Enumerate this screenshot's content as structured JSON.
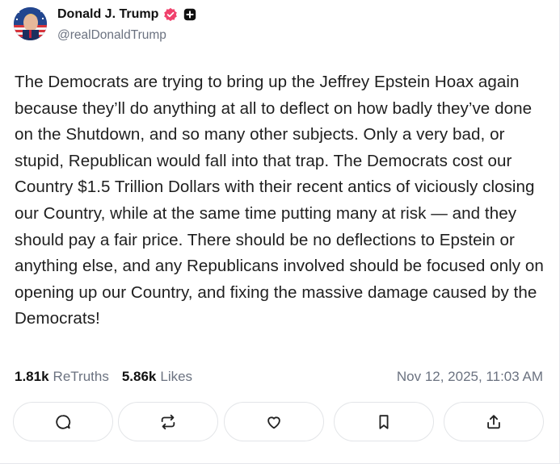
{
  "author": {
    "display_name": "Donald J. Trump",
    "handle": "@realDonaldTrump",
    "verified": true,
    "avatar_icon": "profile-avatar-flag"
  },
  "post": {
    "text": "The Democrats are trying to bring up the Jeffrey Epstein Hoax again because they’ll do anything at all to deflect on how badly they’ve done on the Shutdown, and so many other subjects. Only a very bad, or stupid, Republican would fall into that trap. The Democrats cost our Country $1.5 Trillion Dollars with their recent antics of viciously closing our Country, while at the same time putting many at risk — and they should pay a fair price. There should be no deflections to Epstein or anything else, and any Republicans involved should be focused only on opening up our Country, and fixing the massive damage caused by the Democrats!"
  },
  "stats": {
    "retruths_count": "1.81k",
    "retruths_label": "ReTruths",
    "likes_count": "5.86k",
    "likes_label": "Likes",
    "timestamp": "Nov 12, 2025, 11:03 AM"
  },
  "actions": [
    {
      "icon": "reply-icon"
    },
    {
      "icon": "retruth-icon"
    },
    {
      "icon": "like-icon"
    },
    {
      "icon": "bookmark-icon"
    },
    {
      "icon": "share-icon"
    }
  ],
  "colors": {
    "verified_badge": "#f0416c",
    "text": "#1f1f1f",
    "muted": "#6b7280",
    "button_border": "#e3e5e8"
  }
}
